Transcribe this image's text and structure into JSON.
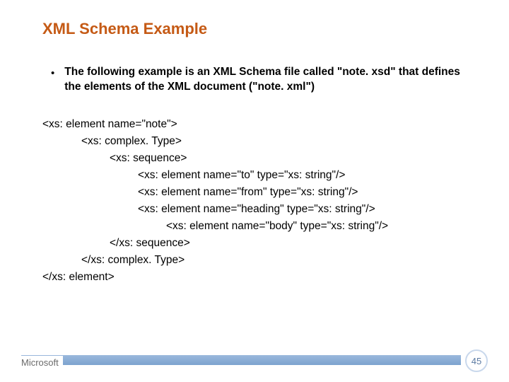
{
  "title": "XML Schema Example",
  "bullet": "The following example is an XML Schema file called \"note. xsd\" that defines the elements of the XML document (\"note. xml\")",
  "code": {
    "l0": "<xs: element name=\"note\">",
    "l1": "<xs: complex. Type>",
    "l2": "<xs: sequence>",
    "l3": "<xs: element name=\"to\" type=\"xs: string\"/>",
    "l4": "<xs: element name=\"from\" type=\"xs: string\"/>",
    "l5": "<xs: element name=\"heading\" type=\"xs: string\"/>",
    "l6": "<xs: element name=\"body\" type=\"xs: string\"/>",
    "l7": "</xs: sequence>",
    "l8": "</xs: complex. Type>",
    "l9": "</xs: element>"
  },
  "footer": {
    "brand": "Microsoft",
    "page": "45"
  }
}
